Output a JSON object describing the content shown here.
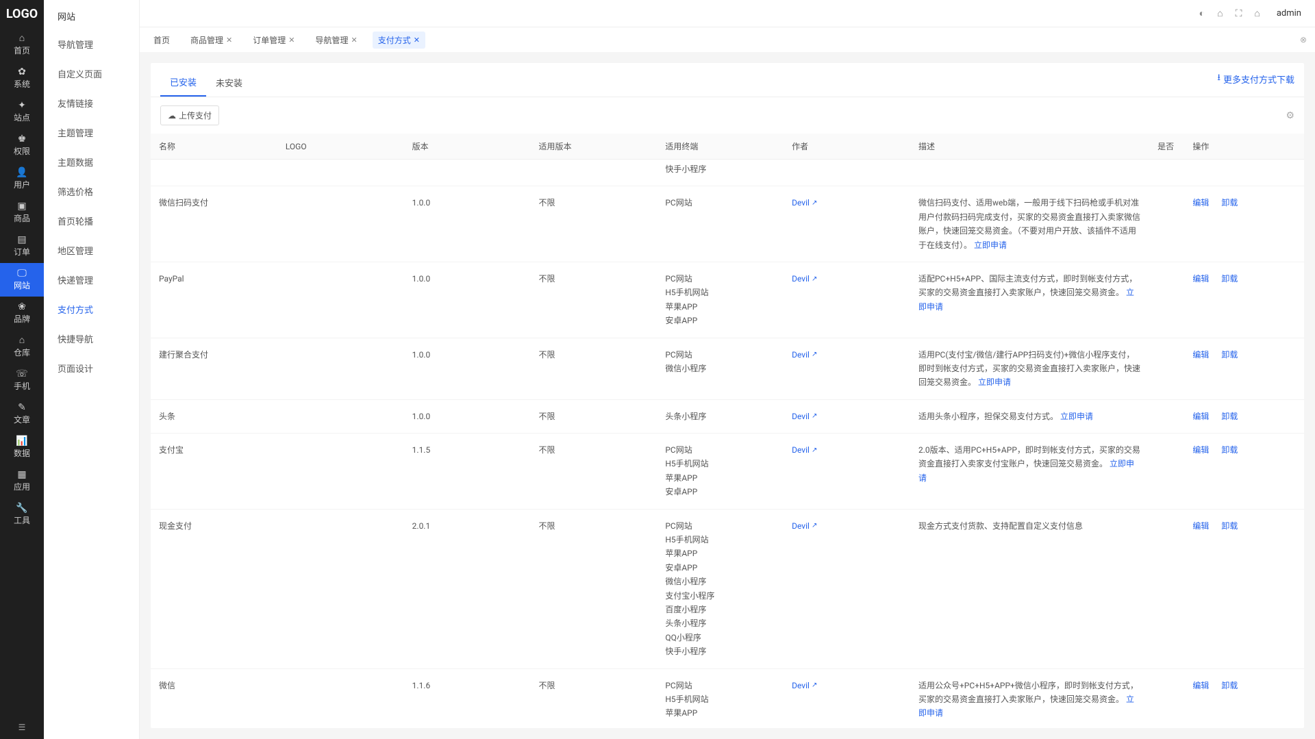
{
  "logo": "LOGO",
  "user": "admin",
  "sideLeft": [
    {
      "icon": "⌂",
      "label": "首页"
    },
    {
      "icon": "✿",
      "label": "系统"
    },
    {
      "icon": "✦",
      "label": "站点"
    },
    {
      "icon": "♚",
      "label": "权限"
    },
    {
      "icon": "👤",
      "label": "用户"
    },
    {
      "icon": "▣",
      "label": "商品"
    },
    {
      "icon": "▤",
      "label": "订单"
    },
    {
      "icon": "🖵",
      "label": "网站",
      "active": true
    },
    {
      "icon": "❀",
      "label": "品牌"
    },
    {
      "icon": "⌂",
      "label": "仓库"
    },
    {
      "icon": "☏",
      "label": "手机"
    },
    {
      "icon": "✎",
      "label": "文章"
    },
    {
      "icon": "📊",
      "label": "数据"
    },
    {
      "icon": "▦",
      "label": "应用"
    },
    {
      "icon": "🔧",
      "label": "工具"
    }
  ],
  "subTitle": "网站",
  "subItems": [
    "导航管理",
    "自定义页面",
    "友情链接",
    "主题管理",
    "主题数据",
    "筛选价格",
    "首页轮播",
    "地区管理",
    "快递管理",
    "支付方式",
    "快捷导航",
    "页面设计"
  ],
  "subActive": "支付方式",
  "tabs": [
    {
      "label": "首页",
      "closable": false
    },
    {
      "label": "商品管理",
      "closable": true
    },
    {
      "label": "订单管理",
      "closable": true
    },
    {
      "label": "导航管理",
      "closable": true
    },
    {
      "label": "支付方式",
      "closable": true,
      "active": true
    }
  ],
  "panelTabs": {
    "installed": "已安装",
    "notInstalled": "未安装"
  },
  "moreLink": "更多支付方式下载",
  "uploadBtn": "上传支付",
  "columns": [
    "名称",
    "LOGO",
    "版本",
    "适用版本",
    "适用终端",
    "作者",
    "描述",
    "是否",
    "操作"
  ],
  "ops": {
    "edit": "编辑",
    "remove": "卸载"
  },
  "applyLink": "立即申请",
  "rows": [
    {
      "name": "",
      "logo": "",
      "version": "",
      "app": "",
      "terminals": [
        "快手小程序"
      ],
      "author": "",
      "desc": "",
      "partial": true
    },
    {
      "name": "微信扫码支付",
      "version": "1.0.0",
      "app": "不限",
      "terminals": [
        "PC网站"
      ],
      "author": "Devil",
      "desc": "微信扫码支付、适用web端，一般用于线下扫码枪或手机对准用户付款码扫码完成支付，买家的交易资金直接打入卖家微信账户，快速回笼交易资金。（不要对用户开放、该插件不适用于在线支付）。",
      "applyLink": true
    },
    {
      "name": "PayPal",
      "version": "1.0.0",
      "app": "不限",
      "terminals": [
        "PC网站",
        "H5手机网站",
        "苹果APP",
        "安卓APP"
      ],
      "author": "Devil",
      "desc": "适配PC+H5+APP、国际主流支付方式，即时到帐支付方式，买家的交易资金直接打入卖家账户，快速回笼交易资金。",
      "applyLink": true
    },
    {
      "name": "建行聚合支付",
      "version": "1.0.0",
      "app": "不限",
      "terminals": [
        "PC网站",
        "微信小程序"
      ],
      "author": "Devil",
      "desc": "适用PC(支付宝/微信/建行APP扫码支付)+微信小程序支付，即时到帐支付方式，买家的交易资金直接打入卖家账户，快速回笼交易资金。",
      "applyLink": true
    },
    {
      "name": "头条",
      "version": "1.0.0",
      "app": "不限",
      "terminals": [
        "头条小程序"
      ],
      "author": "Devil",
      "desc": "适用头条小程序，担保交易支付方式。",
      "applyLink": true
    },
    {
      "name": "支付宝",
      "version": "1.1.5",
      "app": "不限",
      "terminals": [
        "PC网站",
        "H5手机网站",
        "苹果APP",
        "安卓APP"
      ],
      "author": "Devil",
      "desc": "2.0版本、适用PC+H5+APP，即时到帐支付方式，买家的交易资金直接打入卖家支付宝账户，快速回笼交易资金。",
      "applyLink": true
    },
    {
      "name": "现金支付",
      "version": "2.0.1",
      "app": "不限",
      "terminals": [
        "PC网站",
        "H5手机网站",
        "苹果APP",
        "安卓APP",
        "微信小程序",
        "支付宝小程序",
        "百度小程序",
        "头条小程序",
        "QQ小程序",
        "快手小程序"
      ],
      "author": "Devil",
      "desc": "现金方式支付货款、支持配置自定义支付信息"
    },
    {
      "name": "微信",
      "version": "1.1.6",
      "app": "不限",
      "terminals": [
        "PC网站",
        "H5手机网站",
        "苹果APP"
      ],
      "author": "Devil",
      "desc": "适用公众号+PC+H5+APP+微信小程序，即时到帐支付方式，买家的交易资金直接打入卖家账户，快速回笼交易资金。",
      "applyLink": true,
      "cutoff": true
    }
  ]
}
